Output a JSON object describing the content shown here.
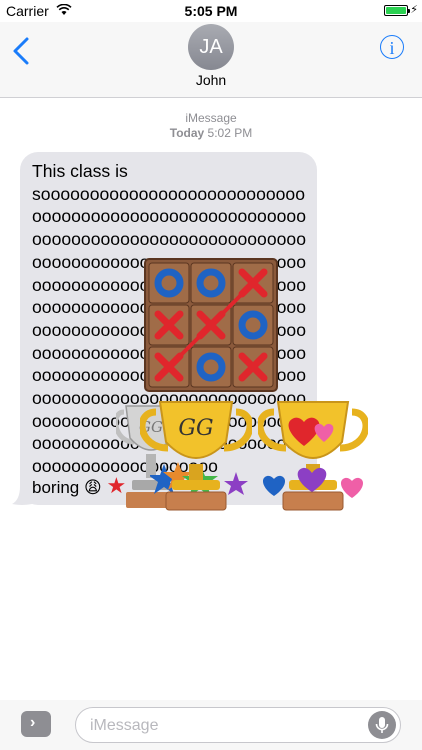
{
  "status_bar": {
    "carrier": "Carrier",
    "time": "5:05 PM"
  },
  "nav": {
    "avatar_initials": "JA",
    "contact_name": "John",
    "info_glyph": "i"
  },
  "thread": {
    "service": "iMessage",
    "day": "Today",
    "time": "5:02 PM"
  },
  "message": {
    "first_line": "This class is",
    "body": "soooooooooooooooooooooooooooooooooooooooooooooooooooooooooooooooooooooooooooooooooooooooooooooooooooooooooooooooooooooooooooooooooooooooooooooooooooooooooooooooooooooooooooooooooooooooooooooooooooooooooooooooooooooooooooooooooooooooooooooooooooooooooooooooooooooooooooooooooooooooooooooooooooooooooooooooooooooooooooooooooooooooooooooooooooooooooooooooooo",
    "last_word": "boring",
    "emoji": [
      "😩",
      "★"
    ]
  },
  "stickers": {
    "tictactoe": {
      "cells": [
        "O",
        "O",
        "X",
        "X",
        "X",
        "O",
        "X",
        "O",
        "X"
      ]
    },
    "trophy_gg": {
      "engraving": "GG"
    },
    "trophy_silver": {
      "engraving": "GG"
    }
  },
  "composer": {
    "placeholder": "iMessage"
  },
  "colors": {
    "accent": "#1a7cfa",
    "bubble": "#e5e5ea",
    "board": "#8b5a3c",
    "x_mark": "#e0262c",
    "o_mark": "#1f63c4",
    "trophy": "#f2c22b"
  }
}
